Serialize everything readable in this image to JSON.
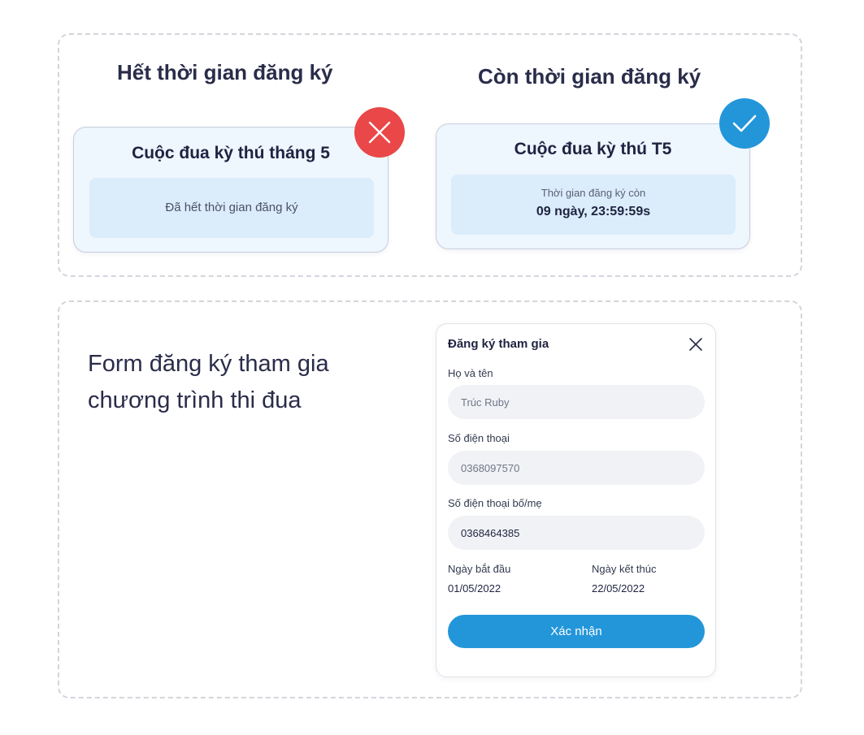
{
  "expired_section": {
    "title": "Hết thời gian đăng ký",
    "card_title": "Cuộc đua kỳ thú tháng 5",
    "message": "Đã hết thời gian đăng ký",
    "badge_icon": "x-icon",
    "badge_color": "#ea4748"
  },
  "open_section": {
    "title": "Còn thời gian đăng ký",
    "card_title": "Cuộc đua kỳ thú T5",
    "countdown_label": "Thời gian đăng ký còn",
    "countdown_value": "09 ngày, 23:59:59s",
    "badge_icon": "check-icon",
    "badge_color": "#2396da"
  },
  "form_caption": {
    "line1": "Form đăng ký tham gia",
    "line2": "chương trình thi đua"
  },
  "form": {
    "title": "Đăng ký tham gia",
    "close_icon": "close-icon",
    "name_label": "Họ và tên",
    "name_placeholder": "Trúc Ruby",
    "phone_label": "Số điện thoại",
    "phone_value": "0368097570",
    "parent_phone_label": "Số điện thoại bố/mẹ",
    "parent_phone_value": "0368464385",
    "start_label": "Ngày bắt đầu",
    "start_value": "01/05/2022",
    "end_label": "Ngày kết thúc",
    "end_value": "22/05/2022",
    "submit_label": "Xác nhận",
    "accent_color": "#2396da"
  }
}
